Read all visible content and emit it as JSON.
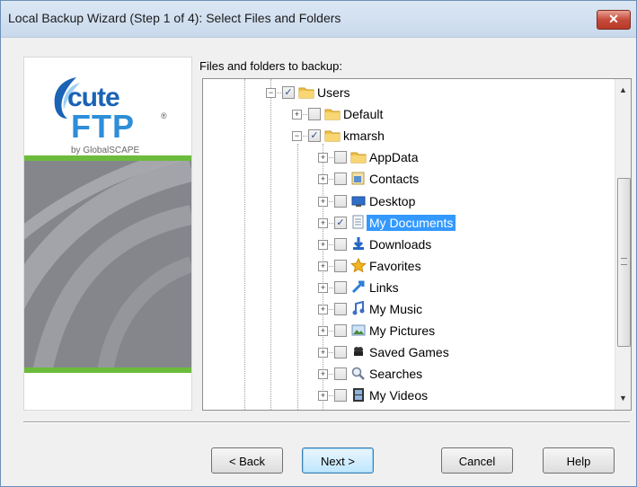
{
  "window": {
    "title": "Local Backup Wizard (Step 1 of 4): Select Files and Folders",
    "close_label": "✕"
  },
  "logo": {
    "word1": "cute",
    "word2": "FTP",
    "reg": "®",
    "by": "by GlobalSCAPE"
  },
  "files_label": "Files and folders to backup:",
  "tree": {
    "items": [
      {
        "label": "Users",
        "checked": true,
        "icon": "folder-icon",
        "expanded": true
      },
      {
        "label": "Default",
        "checked": false,
        "icon": "folder-icon",
        "expanded": false
      },
      {
        "label": "kmarsh",
        "checked": true,
        "icon": "folder-icon",
        "expanded": true
      },
      {
        "label": "AppData",
        "checked": false,
        "icon": "folder-icon",
        "expanded": false
      },
      {
        "label": "Contacts",
        "checked": false,
        "icon": "contacts-icon",
        "expanded": false
      },
      {
        "label": "Desktop",
        "checked": false,
        "icon": "desktop-icon",
        "expanded": false
      },
      {
        "label": "My Documents",
        "checked": true,
        "icon": "documents-icon",
        "expanded": false,
        "selected": true
      },
      {
        "label": "Downloads",
        "checked": false,
        "icon": "downloads-icon",
        "expanded": false
      },
      {
        "label": "Favorites",
        "checked": false,
        "icon": "favorites-icon",
        "expanded": false
      },
      {
        "label": "Links",
        "checked": false,
        "icon": "links-icon",
        "expanded": false
      },
      {
        "label": "My Music",
        "checked": false,
        "icon": "music-icon",
        "expanded": false
      },
      {
        "label": "My Pictures",
        "checked": false,
        "icon": "pictures-icon",
        "expanded": false
      },
      {
        "label": "Saved Games",
        "checked": false,
        "icon": "saved-games-icon",
        "expanded": false
      },
      {
        "label": "Searches",
        "checked": false,
        "icon": "searches-icon",
        "expanded": false
      },
      {
        "label": "My Videos",
        "checked": false,
        "icon": "videos-icon",
        "expanded": false
      }
    ]
  },
  "buttons": {
    "back": "< Back",
    "next": "Next >",
    "cancel": "Cancel",
    "help": "Help"
  },
  "colors": {
    "selection": "#3399ff",
    "logo_green": "#6cbb3c",
    "logo_blue": "#1a63b5"
  }
}
